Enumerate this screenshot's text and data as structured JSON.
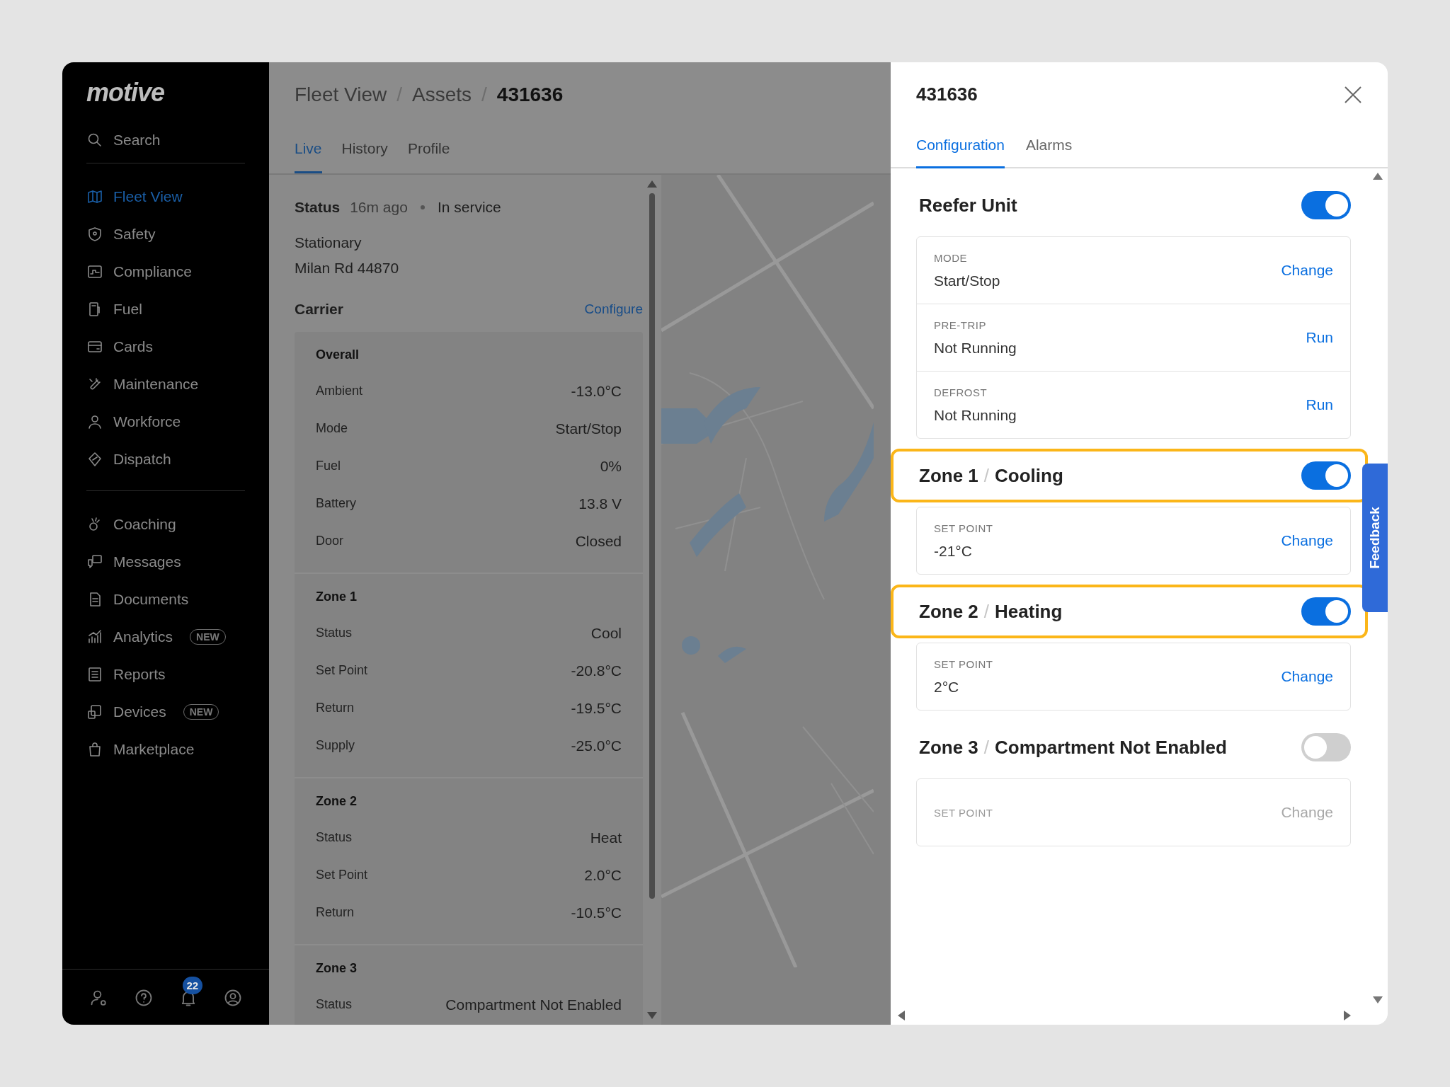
{
  "sidebar": {
    "logo": "motive",
    "search": {
      "placeholder": "Search"
    },
    "groups": [
      [
        {
          "label": "Fleet View",
          "selected": true
        },
        {
          "label": "Safety",
          "selected": false
        },
        {
          "label": "Compliance",
          "selected": false
        },
        {
          "label": "Fuel",
          "selected": false
        },
        {
          "label": "Cards",
          "selected": false
        },
        {
          "label": "Maintenance",
          "selected": false
        },
        {
          "label": "Workforce",
          "selected": false
        },
        {
          "label": "Dispatch",
          "selected": false
        }
      ],
      [
        {
          "label": "Coaching",
          "selected": false
        },
        {
          "label": "Messages",
          "selected": false
        },
        {
          "label": "Documents",
          "selected": false
        },
        {
          "label": "Analytics",
          "selected": false,
          "badge": "NEW"
        },
        {
          "label": "Reports",
          "selected": false
        },
        {
          "label": "Devices",
          "selected": false,
          "badge": "NEW"
        },
        {
          "label": "Marketplace",
          "selected": false
        }
      ]
    ],
    "notification_count": "22"
  },
  "main": {
    "breadcrumb": [
      "Fleet View",
      "Assets",
      "431636"
    ],
    "breadcrumb_separator": "/",
    "tabs": [
      {
        "label": "Live",
        "selected": true
      },
      {
        "label": "History",
        "selected": false
      },
      {
        "label": "Profile",
        "selected": false
      }
    ],
    "status": {
      "label": "Status",
      "time": "16m ago",
      "state": "In service"
    },
    "motion": "Stationary",
    "location": "Milan Rd 44870",
    "carrier": {
      "title": "Carrier",
      "action": "Configure",
      "sections": [
        {
          "title": "Overall",
          "rows": [
            {
              "label": "Ambient",
              "value": "-13.0°C"
            },
            {
              "label": "Mode",
              "value": "Start/Stop"
            },
            {
              "label": "Fuel",
              "value": "0%"
            },
            {
              "label": "Battery",
              "value": "13.8 V"
            },
            {
              "label": "Door",
              "value": "Closed"
            }
          ]
        },
        {
          "title": "Zone 1",
          "rows": [
            {
              "label": "Status",
              "value": "Cool"
            },
            {
              "label": "Set Point",
              "value": "-20.8°C"
            },
            {
              "label": "Return",
              "value": "-19.5°C"
            },
            {
              "label": "Supply",
              "value": "-25.0°C"
            }
          ]
        },
        {
          "title": "Zone 2",
          "rows": [
            {
              "label": "Status",
              "value": "Heat"
            },
            {
              "label": "Set Point",
              "value": "2.0°C"
            },
            {
              "label": "Return",
              "value": "-10.5°C"
            }
          ]
        },
        {
          "title": "Zone 3",
          "rows": [
            {
              "label": "Status",
              "value": "Compartment Not Enabled"
            }
          ]
        }
      ]
    }
  },
  "drawer": {
    "title": "431636",
    "heading_separator": "/",
    "tabs": [
      {
        "label": "Configuration",
        "selected": true
      },
      {
        "label": "Alarms",
        "selected": false
      }
    ],
    "sections": [
      {
        "title": "Reefer Unit",
        "enabled": true,
        "highlighted": false,
        "rows": [
          {
            "label": "MODE",
            "value": "Start/Stop",
            "action": "Change"
          },
          {
            "label": "PRE-TRIP",
            "value": "Not Running",
            "action": "Run"
          },
          {
            "label": "DEFROST",
            "value": "Not Running",
            "action": "Run"
          }
        ]
      },
      {
        "title": "Zone 1",
        "mode": "Cooling",
        "enabled": true,
        "highlighted": true,
        "rows": [
          {
            "label": "SET POINT",
            "value": "-21°C",
            "action": "Change"
          }
        ]
      },
      {
        "title": "Zone 2",
        "mode": "Heating",
        "enabled": true,
        "highlighted": true,
        "rows": [
          {
            "label": "SET POINT",
            "value": "2°C",
            "action": "Change"
          }
        ]
      },
      {
        "title": "Zone 3",
        "mode": "Compartment Not Enabled",
        "enabled": false,
        "highlighted": false,
        "rows": [
          {
            "label": "SET POINT",
            "action": "Change"
          }
        ]
      }
    ]
  },
  "feedback": "Feedback"
}
